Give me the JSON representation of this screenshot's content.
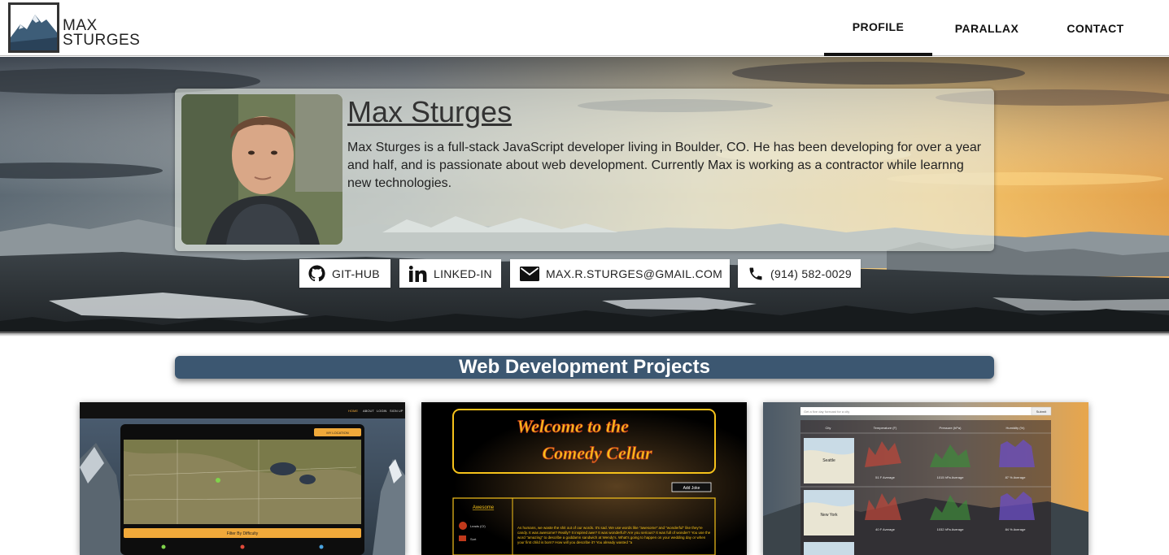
{
  "header": {
    "logo_line1": "MAX",
    "logo_line2": "STURGES",
    "nav": [
      {
        "label": "PROFILE",
        "active": true
      },
      {
        "label": "PARALLAX",
        "active": false
      },
      {
        "label": "CONTACT",
        "active": false
      }
    ]
  },
  "profile": {
    "name": "Max Sturges",
    "bio": "Max Sturges is a full-stack JavaScript developer living in Boulder, CO. He has been developing for over a year and half, and is passionate about web development. Currently Max is working as a contractor while learnng new technologies."
  },
  "contacts": {
    "github": {
      "label": "GIT-HUB",
      "icon": "github-icon"
    },
    "linkedin": {
      "label": "LINKED-IN",
      "icon": "linkedin-icon"
    },
    "email": {
      "label": "MAX.R.STURGES@GMAIL.COM",
      "icon": "envelope-icon"
    },
    "phone": {
      "label": "(914) 582-0029",
      "icon": "phone-icon"
    }
  },
  "projects": {
    "heading": "Web Development Projects",
    "items": [
      {
        "nav": [
          "HOME",
          "ABOUT",
          "LOGIN",
          "SIGN UP"
        ],
        "button": "MY LOCATION",
        "filter": "Filter By Difficulty"
      },
      {
        "title_line1": "Welcome to the",
        "title_line2": "Comedy Cellar",
        "button": "Add Joke",
        "sidebar_title": "Awesome",
        "sidebar_user": "Leads (Cf)",
        "sidebar_tag": "Sort",
        "body_text": "As humans, we waste the shit out of our words. It's sad. We use words like \"awesome\" and \"wonderful\" like they're candy. It was awesome? Really? It inspired awe? It was wonderful? Are you serious? It was full of wonder? You use the word \"amazing\" to describe a goddamn sandwich at Wendy's. What's going to happen on your wedding day or when your first child is born? How will you describe it? You already wasted \"a"
      },
      {
        "search_placeholder": "Get a five day forecast for a city",
        "submit": "Submit",
        "columns": [
          "City",
          "Temperature (F)",
          "Pressure (hPa)",
          "Humidity (%)"
        ],
        "rows": [
          {
            "city": "Seattle",
            "temp": "51 F Average",
            "pressure": "1015 hPa Average",
            "humidity": "87 % Average"
          },
          {
            "city": "New York",
            "temp": "40 F Average",
            "pressure": "1032 hPa Average",
            "humidity": "84 % Average"
          }
        ]
      }
    ]
  },
  "colors": {
    "banner": "#3c5771",
    "nav_active": "#111111",
    "comedy_gold": "#f6c21a",
    "trail_orange": "#f0a93a"
  }
}
